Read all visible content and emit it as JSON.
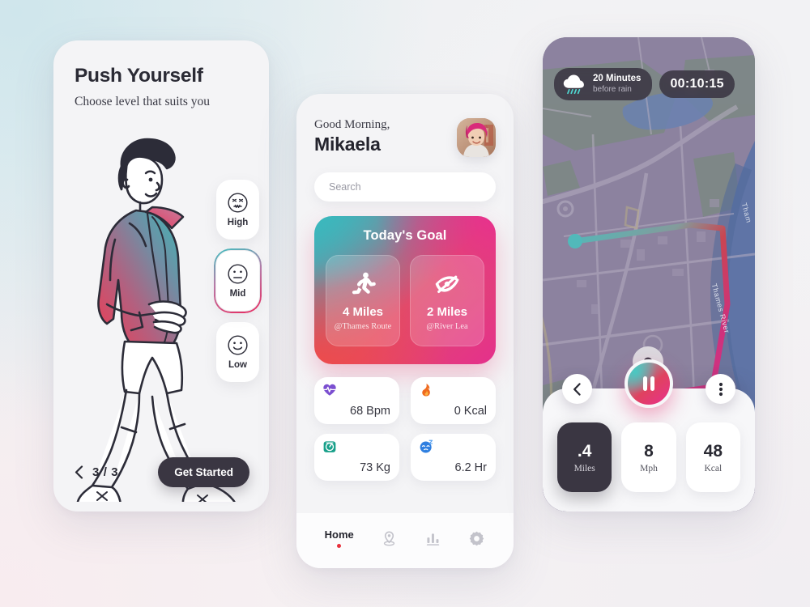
{
  "onboarding": {
    "title": "Push Yourself",
    "subtitle": "Choose level that suits you",
    "levels": [
      {
        "label": "High",
        "face": "strained-face-icon"
      },
      {
        "label": "Mid",
        "face": "neutral-face-icon"
      },
      {
        "label": "Low",
        "face": "smiling-face-icon"
      }
    ],
    "selected_level": "Mid",
    "pager": "3 / 3",
    "cta": "Get Started",
    "illustration": "running-person-illustration",
    "accent_gradient": [
      "#3fc0bf",
      "#e8295f"
    ]
  },
  "home": {
    "greeting": "Good Morning,",
    "user_name": "Mikaela",
    "avatar": "user-avatar",
    "search": {
      "value": "",
      "placeholder": "Search"
    },
    "goal": {
      "title": "Today's Goal",
      "tiles": [
        {
          "icon": "running-icon",
          "value": "4 Miles",
          "location": "@Thames Route"
        },
        {
          "icon": "kayak-icon",
          "value": "2 Miles",
          "location": "@River Lea"
        }
      ],
      "gradient": [
        "#34b6bd",
        "#e04a6e",
        "#e5308c"
      ]
    },
    "stats": [
      {
        "icon": "heart-pulse-icon",
        "value": "68 Bpm",
        "color": "#7b4fd0"
      },
      {
        "icon": "flame-icon",
        "value": "0 Kcal",
        "color": "#ef6a1e"
      },
      {
        "icon": "weight-scale-icon",
        "value": "73 Kg",
        "color": "#18a08a"
      },
      {
        "icon": "sleeping-face-icon",
        "value": "6.2 Hr",
        "color": "#2f7fe0"
      }
    ],
    "tabs": [
      {
        "label": "Home",
        "icon": "",
        "active": true
      },
      {
        "label": "",
        "icon": "location-pin-icon",
        "active": false
      },
      {
        "label": "",
        "icon": "bar-chart-icon",
        "active": false
      },
      {
        "label": "",
        "icon": "gear-icon",
        "active": false
      }
    ]
  },
  "tracker": {
    "weather": {
      "icon": "rain-cloud-icon",
      "primary": "20 Minutes",
      "secondary": "before rain"
    },
    "timer": "00:10:15",
    "map": {
      "river_label": "Thames River",
      "river_label_short": "Tham",
      "start_marker": "route-start-dot",
      "end_marker": "route-end-pin",
      "route_gradient": [
        "#4fd6d0",
        "#e8434a",
        "#ef2a8f"
      ]
    },
    "controls": {
      "back": "back-chevron",
      "play_state": "pause-icon",
      "more": "more-options-icon"
    },
    "metrics": [
      {
        "value": ".4",
        "unit": "Miles",
        "active": true
      },
      {
        "value": "8",
        "unit": "Mph",
        "active": false
      },
      {
        "value": "48",
        "unit": "Kcal",
        "active": false
      }
    ]
  }
}
